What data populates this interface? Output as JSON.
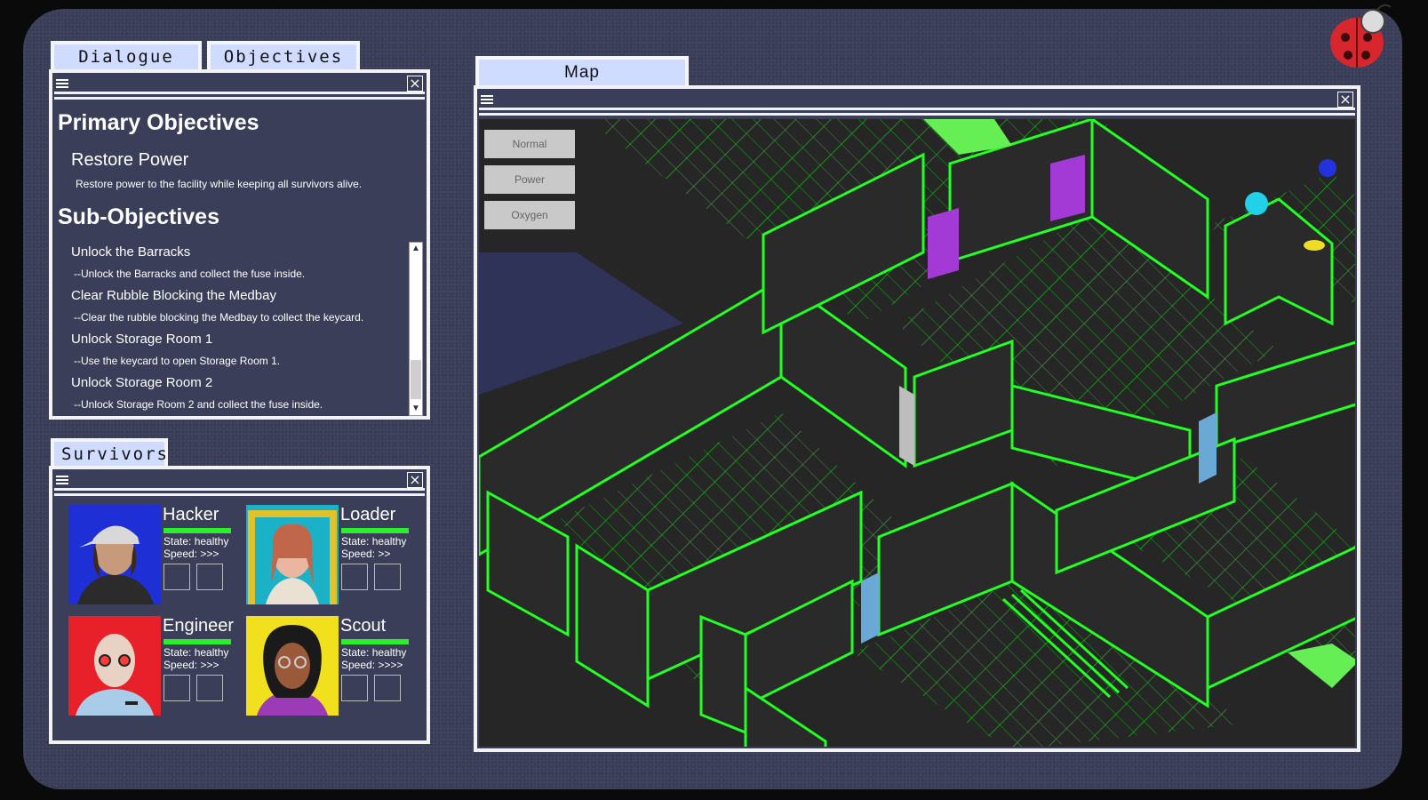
{
  "tabs": {
    "dialogue": "Dialogue",
    "objectives": "Objectives",
    "survivors": "Survivors",
    "map": "Map"
  },
  "objectives": {
    "primary_heading": "Primary Objectives",
    "primary": {
      "title": "Restore Power",
      "description": "Restore power to the facility while keeping all survivors alive."
    },
    "sub_heading": "Sub-Objectives",
    "sub": [
      {
        "title": "Unlock the Barracks",
        "description": "--Unlock the Barracks and collect the fuse inside."
      },
      {
        "title": "Clear Rubble Blocking the Medbay",
        "description": "--Clear the rubble blocking the Medbay to collect the keycard."
      },
      {
        "title": "Unlock Storage Room 1",
        "description": "--Use the keycard to open Storage Room 1."
      },
      {
        "title": "Unlock Storage Room 2",
        "description": "--Unlock Storage Room 2 and collect the fuse inside."
      }
    ],
    "scroll_position": 0.75
  },
  "survivors": [
    {
      "name": "Hacker",
      "state": "State: healthy",
      "speed": "Speed: >>>",
      "portrait_bg": "#1f2fd6",
      "health": 1.0
    },
    {
      "name": "Loader",
      "state": "State: healthy",
      "speed": "Speed: >>",
      "portrait_bg": "#1bb2c8",
      "health": 1.0
    },
    {
      "name": "Engineer",
      "state": "State: healthy",
      "speed": "Speed: >>>",
      "portrait_bg": "#e8202a",
      "health": 1.0
    },
    {
      "name": "Scout",
      "state": "State: healthy",
      "speed": "Speed: >>>>",
      "portrait_bg": "#f0e01e",
      "health": 1.0
    }
  ],
  "map": {
    "modes": [
      "Normal",
      "Power",
      "Oxygen"
    ],
    "grid_color": "#22ee22"
  },
  "icons": {
    "menu": "hamburger-icon",
    "close": "close-icon",
    "bug": "ladybug-icon"
  },
  "colors": {
    "tab_bg": "#cfdcff",
    "panel_bg": "#3a3e58",
    "border": "#f2f2f2",
    "health_bar": "#2bef2b"
  }
}
